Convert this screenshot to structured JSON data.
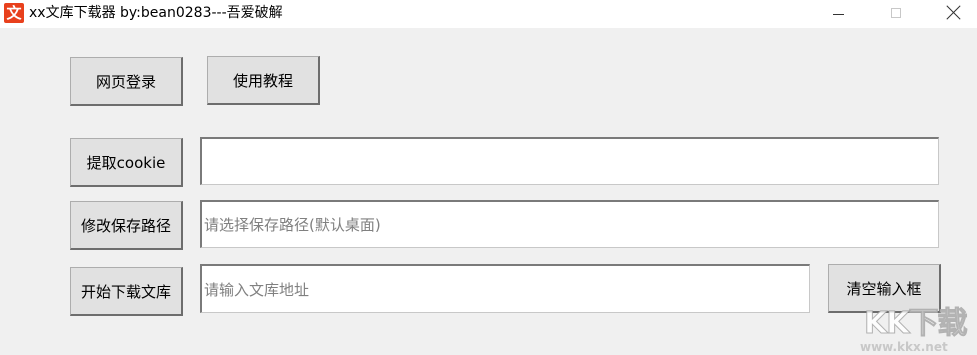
{
  "window": {
    "icon_glyph": "文",
    "title": "xx文库下载器  by:bean0283---吾爱破解",
    "controls": {
      "minimize": "minimize-icon",
      "maximize": "maximize-icon",
      "close": "close-icon"
    }
  },
  "buttons": {
    "login": "网页登录",
    "tutorial": "使用教程",
    "get_cookie": "提取cookie",
    "change_path": "修改保存路径",
    "start_download": "开始下载文库",
    "clear_input": "清空输入框"
  },
  "fields": {
    "cookie": {
      "value": "",
      "placeholder": ""
    },
    "save_path": {
      "value": "",
      "placeholder": "请选择保存路径(默认桌面)"
    },
    "doc_url": {
      "value": "",
      "placeholder": "请输入文库地址"
    }
  },
  "watermark": {
    "text": "KK下载",
    "url": "www.kkx.net"
  }
}
